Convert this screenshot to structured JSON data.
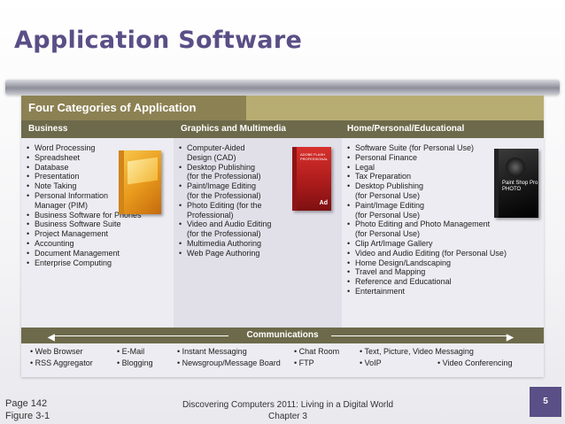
{
  "slide": {
    "title": "Application Software",
    "page_number": "5"
  },
  "figure": {
    "header": "Four Categories of Application Software",
    "categories": {
      "business": "Business",
      "graphics": "Graphics and Multimedia",
      "home": "Home/Personal/Educational"
    },
    "business_items": [
      "Word Processing",
      "Spreadsheet",
      "Database",
      "Presentation",
      "Note Taking",
      "Personal Information",
      "Manager (PIM)",
      "Business Software for Phones",
      "Business Software Suite",
      "Project Management",
      "Accounting",
      "Document Management",
      "Enterprise Computing"
    ],
    "graphics_items": [
      "Computer-Aided",
      "Design (CAD)",
      "Desktop Publishing",
      "(for the Professional)",
      "Paint/Image Editing",
      "(for the Professional)",
      "Photo Editing (for the",
      "Professional)",
      "Video and Audio Editing",
      "(for the Professional)",
      "Multimedia Authoring",
      "Web Page Authoring"
    ],
    "home_items": [
      "Software Suite (for Personal Use)",
      "Personal Finance",
      "Legal",
      "Tax Preparation",
      "Desktop Publishing",
      "(for Personal Use)",
      "Paint/Image Editing",
      "(for Personal Use)",
      "Photo Editing and Photo Management",
      "(for Personal Use)",
      "Clip Art/Image Gallery",
      "Video and Audio Editing (for Personal Use)",
      "Home Design/Landscaping",
      "Travel and Mapping",
      "Reference and Educational",
      "Entertainment"
    ],
    "box_adobe_text": "ADOBE FLASH PROFESSIONAL",
    "box_adobe_logo": "Ad",
    "box_paint_text": "Paint Shop Pro PHOTO",
    "communications_header": "Communications",
    "communications_items": {
      "web_browser": "Web Browser",
      "rss": "RSS Aggregator",
      "email": "E-Mail",
      "blogging": "Blogging",
      "im": "Instant Messaging",
      "newsgroup": "Newsgroup/Message Board",
      "chat": "Chat Room",
      "ftp": "FTP",
      "text_msg": "Text, Picture, Video Messaging",
      "voip": "VoIP",
      "video_conf": "Video Conferencing"
    }
  },
  "footer": {
    "page_ref": "Page 142",
    "figure_ref": "Figure 3-1",
    "book_title": "Discovering Computers 2011: Living in a Digital World",
    "chapter": "Chapter 3"
  },
  "colors": {
    "title": "#5a4f86",
    "header_dark": "#8c8153",
    "header_light": "#b7ad72",
    "category_bar": "#6d6a4b",
    "page_badge": "#5a4f86"
  }
}
